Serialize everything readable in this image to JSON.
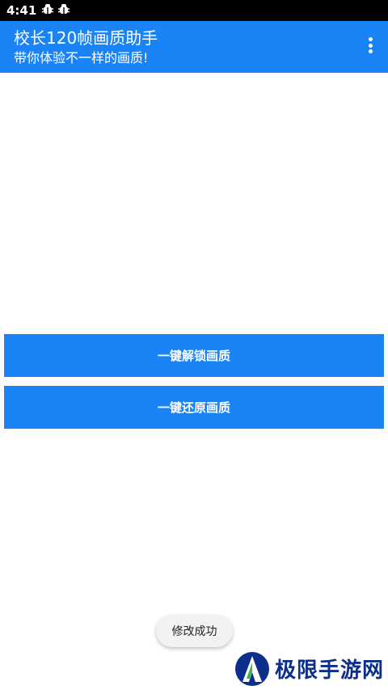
{
  "status_bar": {
    "time": "4:41",
    "notification_icons": [
      "bug-icon",
      "bug-icon"
    ]
  },
  "app_bar": {
    "title": "校长120帧画质助手",
    "subtitle": "带你体验不一样的画质!",
    "background_color": "#1a84f7",
    "menu_icon": "more-vert-icon"
  },
  "buttons": {
    "unlock_label": "一键解锁画质",
    "restore_label": "一键还原画质",
    "color": "#1a84f7"
  },
  "toast": {
    "message": "修改成功"
  },
  "watermark": {
    "text": "极限手游网",
    "logo_icon": "jixian-logo-icon"
  }
}
